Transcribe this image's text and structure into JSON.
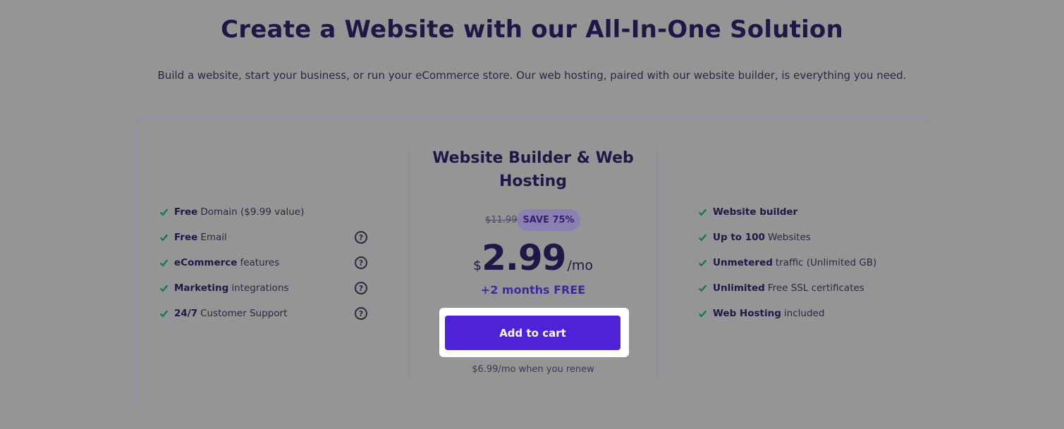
{
  "header": {
    "title": "Create a Website with our All-In-One Solution",
    "subtitle": "Build a website, start your business, or run your eCommerce store. Our web hosting, paired with our website builder, is everything you need."
  },
  "plan": {
    "name": "Website Builder & Web Hosting",
    "old_price": "$11.99",
    "save_badge": "SAVE 75%",
    "currency": "$",
    "price": "2.99",
    "period": "/mo",
    "bonus": "+2 months FREE",
    "cart_button": "Add to cart",
    "renew_note": "$6.99/mo when you renew"
  },
  "left_features": [
    {
      "bold": "Free",
      "text": "Domain ($9.99 value)",
      "help": false
    },
    {
      "bold": "Free",
      "text": "Email",
      "help": true
    },
    {
      "bold": "eCommerce",
      "text": "features",
      "help": true
    },
    {
      "bold": "Marketing",
      "text": "integrations",
      "help": true
    },
    {
      "bold": "24/7",
      "text": "Customer Support",
      "help": true
    }
  ],
  "right_features": [
    {
      "bold": "Website builder",
      "text": ""
    },
    {
      "bold": "Up to 100",
      "text": "Websites"
    },
    {
      "bold": "Unmetered",
      "text": "traffic (Unlimited GB)"
    },
    {
      "bold": "Unlimited",
      "text": "Free SSL certificates"
    },
    {
      "bold": "Web Hosting",
      "text": "included"
    }
  ],
  "icons": {
    "check": "check-icon",
    "help": "question-circle-icon",
    "help_glyph": "?"
  },
  "colors": {
    "check": "#0e7a5a",
    "cart_button": "#4e22d6",
    "bonus_text": "#3d2a9a",
    "badge_bg": "#8a80b2"
  }
}
